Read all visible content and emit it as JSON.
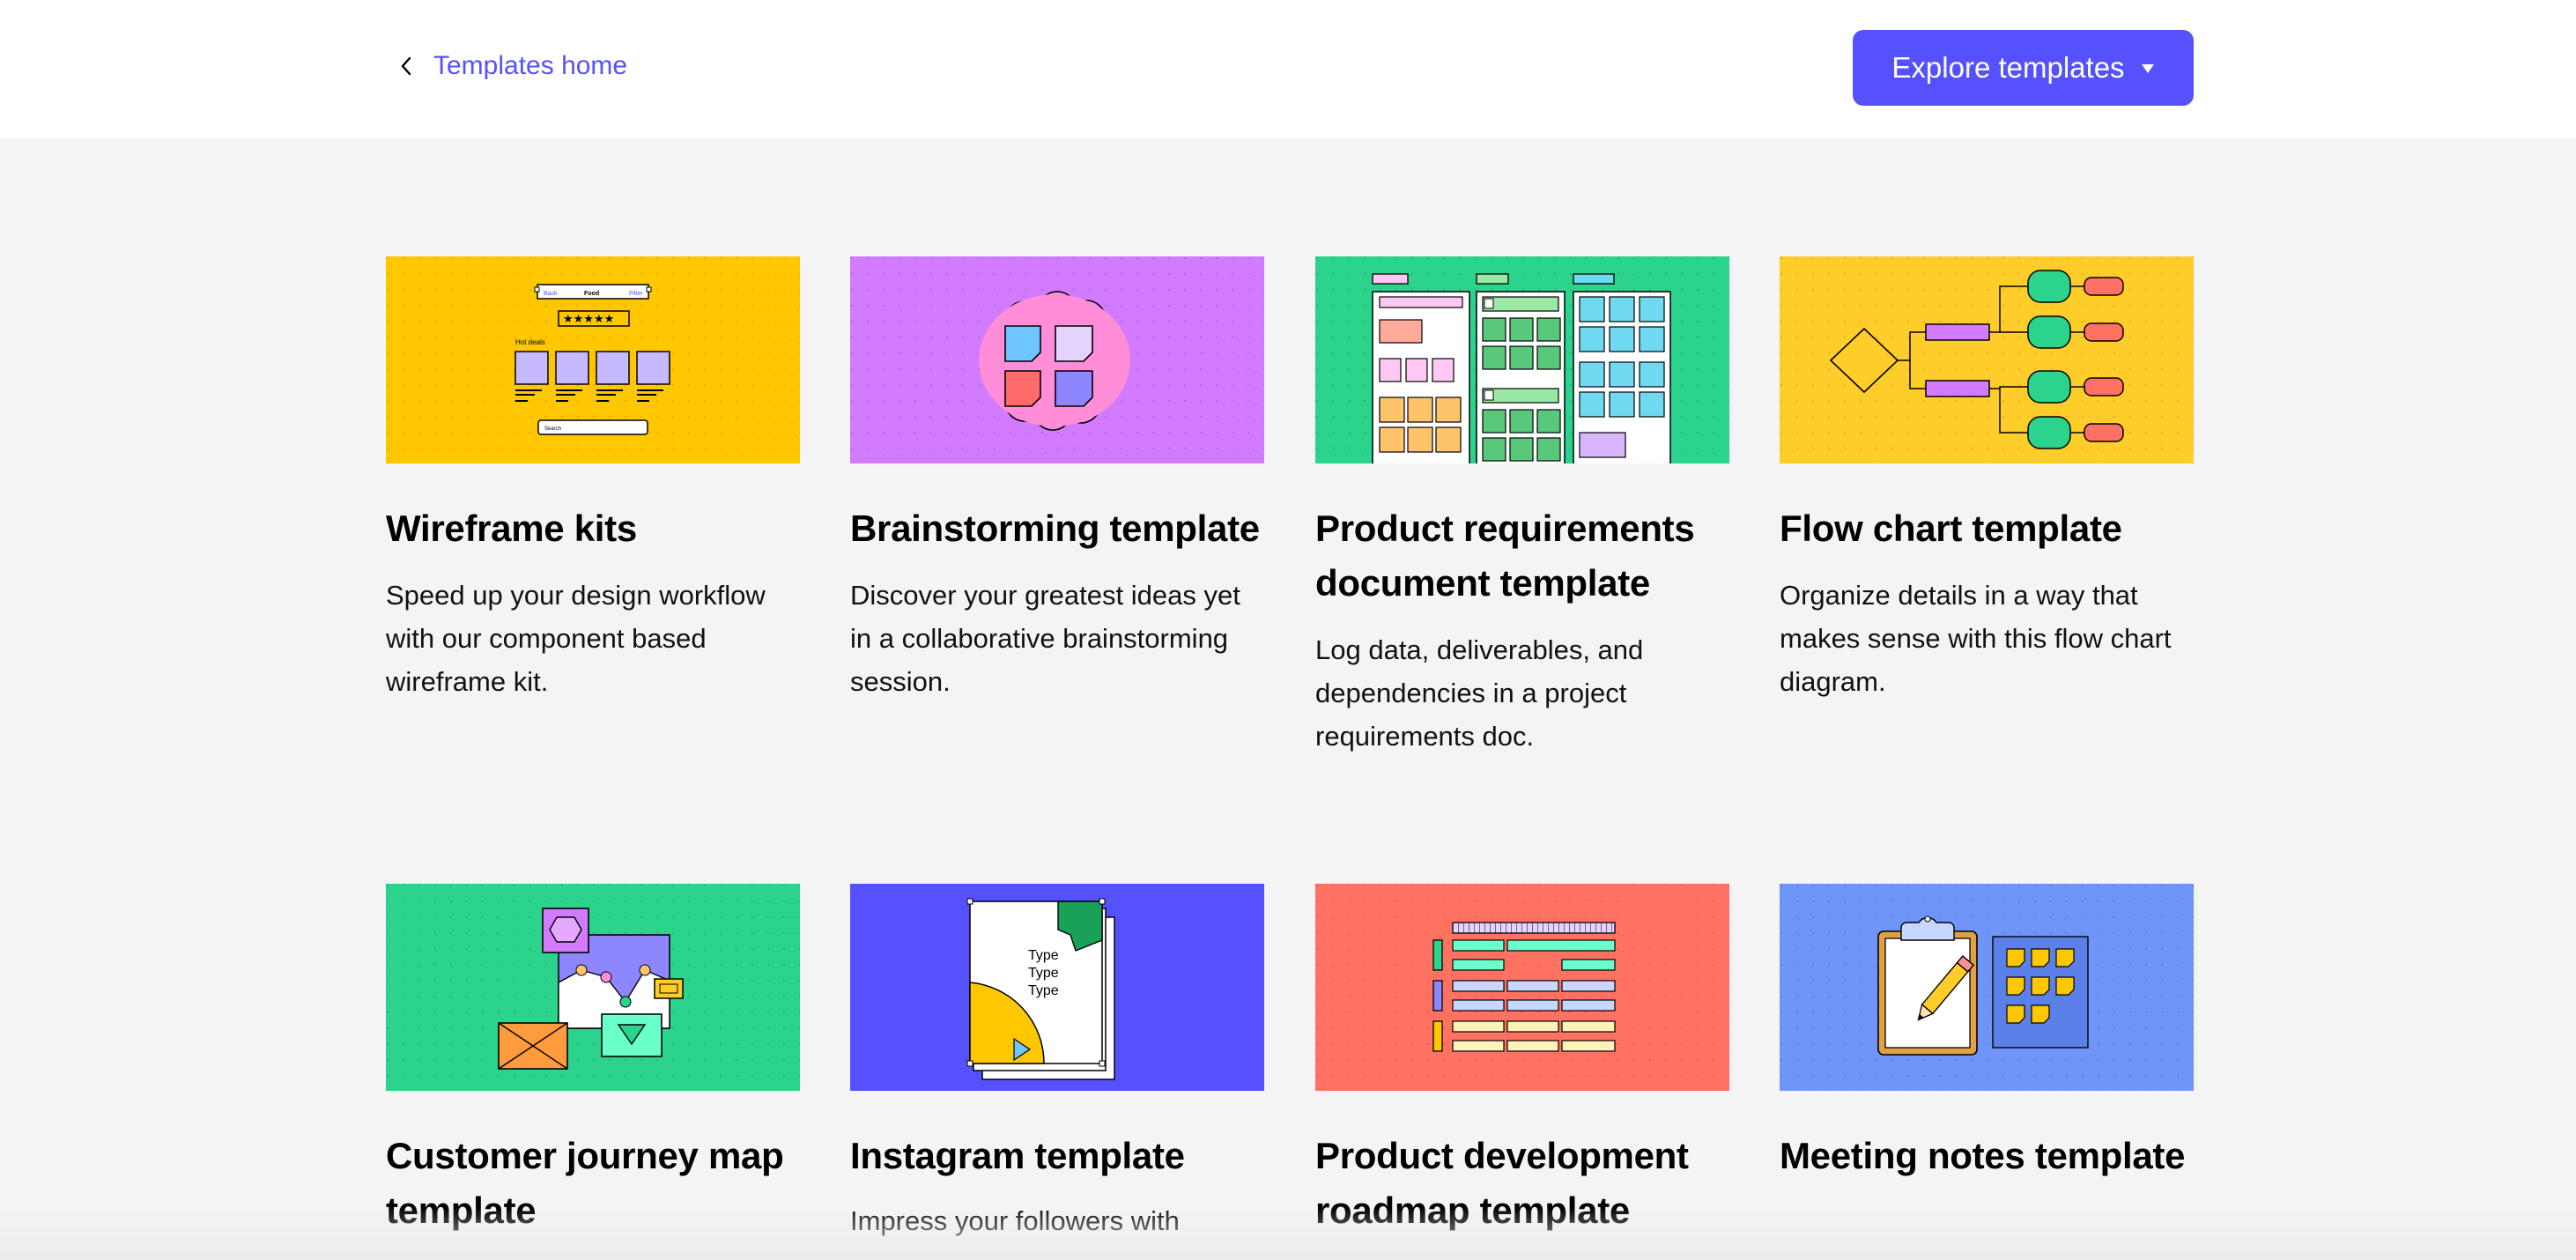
{
  "header": {
    "back_label": "Templates home",
    "explore_label": "Explore templates"
  },
  "cards": [
    {
      "title": "Wireframe kits",
      "description": "Speed up your design workflow with our component based wireframe kit.",
      "thumb_bg": "#ffc700",
      "icon": "wireframe-illustration",
      "thumb_text": {
        "left": "Back",
        "center": "Food",
        "right": "Filter",
        "stars": "★★★★★",
        "deals": "Hot deals",
        "search": "Search"
      }
    },
    {
      "title": "Brainstorming template",
      "description": "Discover your greatest ideas yet in a collaborative brainstorming session.",
      "thumb_bg": "#d27bff",
      "icon": "sticky-notes-cloud-illustration"
    },
    {
      "title": "Product requirements document template",
      "description": "Log data, deliverables, and dependencies in a project requirements doc.",
      "thumb_bg": "#2bd38c",
      "icon": "requirements-board-illustration"
    },
    {
      "title": "Flow chart template",
      "description": "Organize details in a way that makes sense with this flow chart diagram.",
      "thumb_bg": "#ffcd29",
      "icon": "flow-chart-illustration"
    },
    {
      "title": "Customer journey map template",
      "description": "",
      "thumb_bg": "#2bd38c",
      "icon": "journey-map-illustration"
    },
    {
      "title": "Instagram template",
      "description": "Impress your followers with",
      "thumb_bg": "#5551ff",
      "icon": "instagram-post-illustration",
      "thumb_text": {
        "line1": "Type",
        "line2": "Type",
        "line3": "Type"
      }
    },
    {
      "title": "Product development roadmap template",
      "description": "",
      "thumb_bg": "#ff7262",
      "icon": "roadmap-illustration"
    },
    {
      "title": "Meeting notes template",
      "description": "",
      "thumb_bg": "#6e95f7",
      "icon": "clipboard-notes-illustration"
    }
  ],
  "colors": {
    "accent": "#5551ff",
    "page_bg": "#f4f4f4",
    "header_bg": "#ffffff"
  }
}
